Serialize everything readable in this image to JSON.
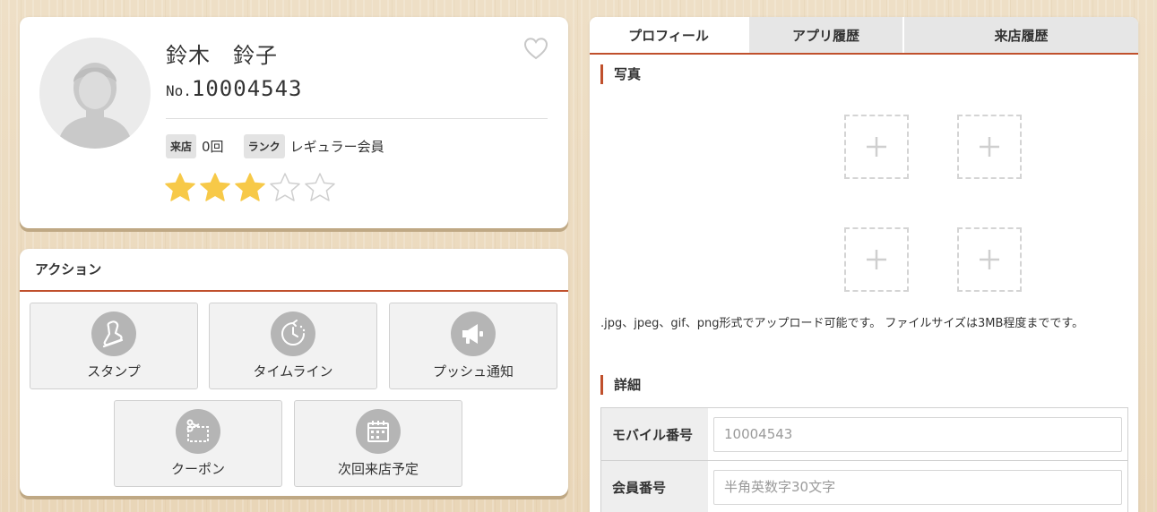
{
  "profile": {
    "name": "鈴木　鈴子",
    "number_prefix": "No.",
    "number": "10004543",
    "visits_label": "来店",
    "visits_value": "0回",
    "rank_label": "ランク",
    "rank_value": "レギュラー会員",
    "rating": 3,
    "rating_max": 5,
    "favorite_icon": "heart-outline-icon"
  },
  "actions": {
    "title": "アクション",
    "items": [
      {
        "label": "スタンプ",
        "icon": "stamp-icon"
      },
      {
        "label": "タイムライン",
        "icon": "clock-icon"
      },
      {
        "label": "プッシュ通知",
        "icon": "megaphone-icon"
      },
      {
        "label": "クーポン",
        "icon": "coupon-scissors-icon"
      },
      {
        "label": "次回来店予定",
        "icon": "calendar-icon"
      }
    ]
  },
  "tabs": [
    {
      "label": "プロフィール",
      "active": true
    },
    {
      "label": "アプリ履歴",
      "active": false
    },
    {
      "label": "来店履歴",
      "active": false
    }
  ],
  "photos": {
    "title": "写真",
    "note": ".jpg、jpeg、gif、png形式でアップロード可能です。 ファイルサイズは3MB程度までです。"
  },
  "details": {
    "title": "詳細",
    "rows": [
      {
        "label": "モバイル番号",
        "placeholder": "10004543"
      },
      {
        "label": "会員番号",
        "placeholder": "半角英数字30文字"
      }
    ]
  },
  "colors": {
    "accent": "#c0502c",
    "star_filled": "#f7c948",
    "icon_gray": "#b5b5b5"
  }
}
